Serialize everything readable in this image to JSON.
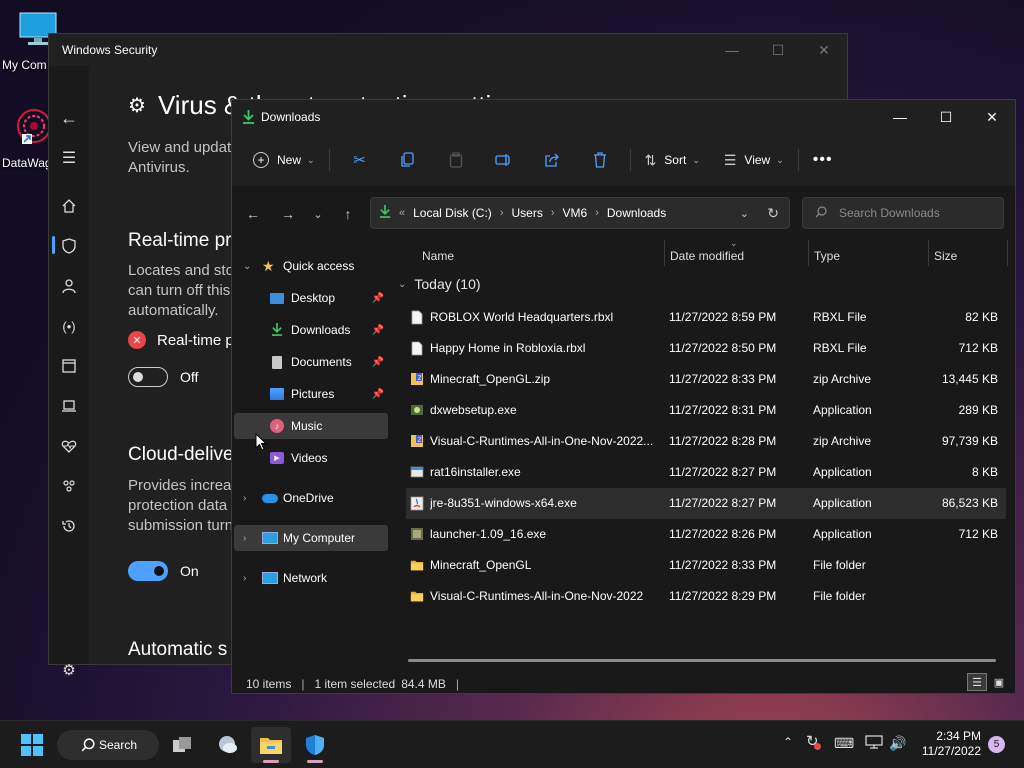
{
  "desktop": {
    "icons": [
      {
        "label": "My Com",
        "icon": "monitor-icon"
      },
      {
        "label": "DataWag",
        "icon": "datawag-app-icon"
      }
    ]
  },
  "windows_security": {
    "title": "Windows Security",
    "page_title": "Virus & threat protection settings",
    "intro_lines": [
      "View and updat",
      "Antivirus."
    ],
    "realtime": {
      "heading": "Real-time pr",
      "desc_lines": [
        "Locates and sto",
        "can turn off this",
        "automatically."
      ],
      "warning_text": "Real-time p",
      "toggle_label": "Off"
    },
    "cloud": {
      "heading": "Cloud-delive",
      "desc_lines": [
        "Provides increas",
        "protection data",
        "submission turn"
      ],
      "toggle_label": "On"
    },
    "automatic": {
      "heading": "Automatic s"
    },
    "rail_icons": [
      "back-arrow-icon",
      "hamburger-icon",
      "home-icon",
      "shield-icon",
      "account-icon",
      "network-icon",
      "app-browser-icon",
      "device-icon",
      "health-icon",
      "family-icon",
      "history-icon",
      "settings-icon"
    ]
  },
  "explorer": {
    "title": "Downloads",
    "toolbar": {
      "new_label": "New",
      "sort_label": "Sort",
      "view_label": "View"
    },
    "address": {
      "crumbs": [
        "Local Disk (C:)",
        "Users",
        "VM6",
        "Downloads"
      ],
      "search_placeholder": "Search Downloads"
    },
    "nav": {
      "quick_access": "Quick access",
      "items": [
        {
          "label": "Desktop",
          "pinned": true
        },
        {
          "label": "Downloads",
          "pinned": true
        },
        {
          "label": "Documents",
          "pinned": true
        },
        {
          "label": "Pictures",
          "pinned": true
        },
        {
          "label": "Music",
          "pinned": false
        },
        {
          "label": "Videos",
          "pinned": false
        }
      ],
      "onedrive": "OneDrive",
      "my_computer": "My Computer",
      "network": "Network"
    },
    "columns": {
      "name": "Name",
      "date": "Date modified",
      "type": "Type",
      "size": "Size"
    },
    "group_label": "Today (10)",
    "files": [
      {
        "name": "ROBLOX World Headquarters.rbxl",
        "date": "11/27/2022 8:59 PM",
        "type": "RBXL File",
        "size": "82 KB",
        "icon": "document-file-icon"
      },
      {
        "name": "Happy Home in Robloxia.rbxl",
        "date": "11/27/2022 8:50 PM",
        "type": "RBXL File",
        "size": "712 KB",
        "icon": "document-file-icon"
      },
      {
        "name": "Minecraft_OpenGL.zip",
        "date": "11/27/2022 8:33 PM",
        "type": "zip Archive",
        "size": "13,445 KB",
        "icon": "zip-archive-icon"
      },
      {
        "name": "dxwebsetup.exe",
        "date": "11/27/2022 8:31 PM",
        "type": "Application",
        "size": "289 KB",
        "icon": "installer-icon"
      },
      {
        "name": "Visual-C-Runtimes-All-in-One-Nov-2022...",
        "date": "11/27/2022 8:28 PM",
        "type": "zip Archive",
        "size": "97,739 KB",
        "icon": "zip-archive-icon"
      },
      {
        "name": "rat16installer.exe",
        "date": "11/27/2022 8:27 PM",
        "type": "Application",
        "size": "8 KB",
        "icon": "application-icon"
      },
      {
        "name": "jre-8u351-windows-x64.exe",
        "date": "11/27/2022 8:27 PM",
        "type": "Application",
        "size": "86,523 KB",
        "icon": "java-installer-icon"
      },
      {
        "name": "launcher-1.09_16.exe",
        "date": "11/27/2022 8:26 PM",
        "type": "Application",
        "size": "712 KB",
        "icon": "launcher-icon"
      },
      {
        "name": "Minecraft_OpenGL",
        "date": "11/27/2022 8:33 PM",
        "type": "File folder",
        "size": "",
        "icon": "folder-icon"
      },
      {
        "name": "Visual-C-Runtimes-All-in-One-Nov-2022",
        "date": "11/27/2022 8:29 PM",
        "type": "File folder",
        "size": "",
        "icon": "folder-icon"
      }
    ],
    "selected_row": 6,
    "status": {
      "items": "10 items",
      "selected": "1 item selected",
      "size": "84.4 MB"
    }
  },
  "taskbar": {
    "search_label": "Search",
    "clock_time": "2:34 PM",
    "clock_date": "11/27/2022",
    "notification_count": "5"
  },
  "colors": {
    "accent": "#4ea1ff",
    "folder": "#f2c34c",
    "warning": "#e8454b"
  }
}
